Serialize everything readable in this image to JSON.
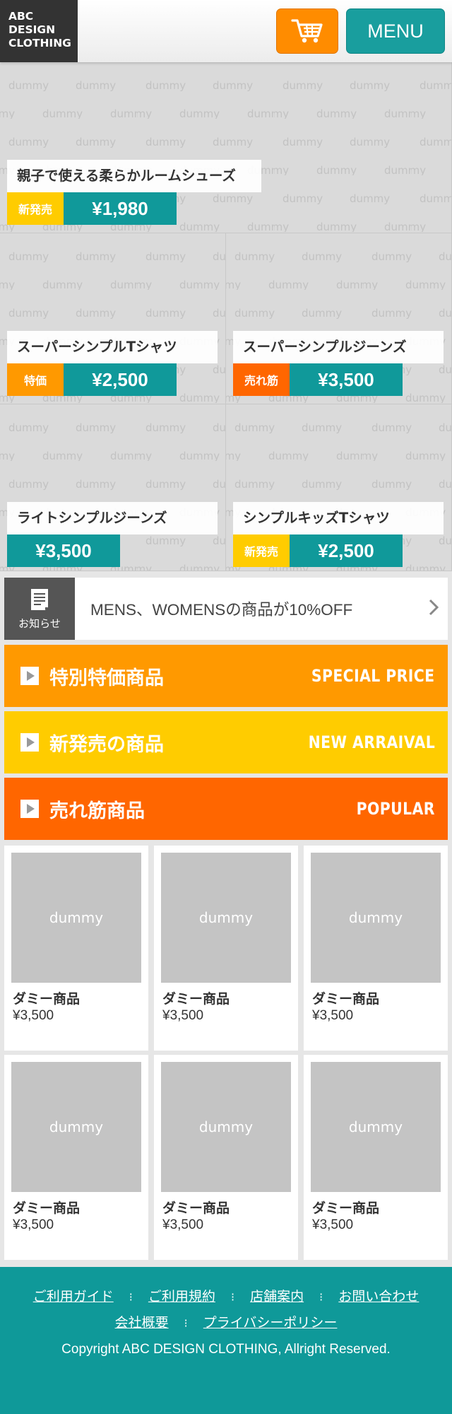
{
  "header": {
    "logo_lines": [
      "ABC",
      "DESIGN",
      "CLOTHING"
    ],
    "menu_label": "MENU",
    "cart_icon": "cart-icon",
    "cart_color": "#ff8c00",
    "menu_color": "#199e9e"
  },
  "hero": {
    "placeholder_text": "dummy",
    "items": [
      {
        "name": "親子で使える柔らかルームシューズ",
        "tag": "新発売",
        "tag_color": "#ffcc00",
        "price": "¥1,980"
      },
      {
        "name": "スーパーシンプルTシャツ",
        "tag": "特価",
        "tag_color": "#ff9900",
        "price": "¥2,500"
      },
      {
        "name": "スーパーシンプルジーンズ",
        "tag": "売れ筋",
        "tag_color": "#ff6600",
        "price": "¥3,500"
      },
      {
        "name": "ライトシンプルジーンズ",
        "tag": "",
        "tag_color": "",
        "price": "¥3,500"
      },
      {
        "name": "シンプルキッズTシャツ",
        "tag": "新発売",
        "tag_color": "#ffcc00",
        "price": "¥2,500"
      }
    ]
  },
  "notice": {
    "label": "お知らせ",
    "icon": "document-icon",
    "text": "MENS、WOMENSの商品が10%OFF",
    "arrow": "chevron-right-icon"
  },
  "categories": [
    {
      "jp": "特別特価商品",
      "en": "SPECIAL PRICE",
      "color": "#ff9900"
    },
    {
      "jp": "新発売の商品",
      "en": "NEW ARRAIVAL",
      "color": "#ffcc00"
    },
    {
      "jp": "売れ筋商品",
      "en": "POPULAR",
      "color": "#ff6600"
    }
  ],
  "products": [
    {
      "image": "dummy",
      "name": "ダミー商品",
      "price": "¥3,500"
    },
    {
      "image": "dummy",
      "name": "ダミー商品",
      "price": "¥3,500"
    },
    {
      "image": "dummy",
      "name": "ダミー商品",
      "price": "¥3,500"
    },
    {
      "image": "dummy",
      "name": "ダミー商品",
      "price": "¥3,500"
    },
    {
      "image": "dummy",
      "name": "ダミー商品",
      "price": "¥3,500"
    },
    {
      "image": "dummy",
      "name": "ダミー商品",
      "price": "¥3,500"
    }
  ],
  "footer": {
    "links_row1": [
      "ご利用ガイド",
      "ご利用規約",
      "店舗案内",
      "お問い合わせ"
    ],
    "links_row2": [
      "会社概要",
      "プライバシーポリシー"
    ],
    "separator": "⁝",
    "copyright": "Copyright ABC DESIGN CLOTHING, Allright Reserved.",
    "color": "#0f9999"
  }
}
